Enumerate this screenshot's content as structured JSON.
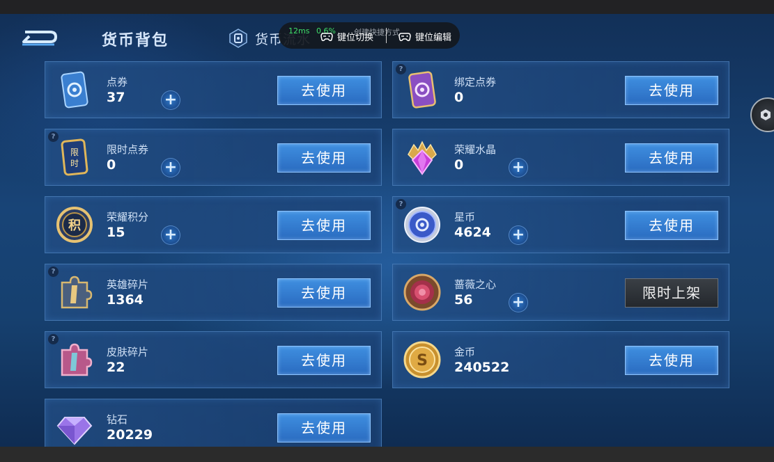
{
  "header": {
    "title": "货币背包",
    "flow_tab": "货币流水"
  },
  "overlay": {
    "latency": "12ms",
    "percent": "0.6%",
    "ghost_text": "创建快捷方式",
    "switch_label": "键位切换",
    "edit_label": "键位编辑"
  },
  "currencies": [
    {
      "name": "点券",
      "amount": "37",
      "plus": true,
      "help": false,
      "action": "去使用"
    },
    {
      "name": "绑定点券",
      "amount": "0",
      "plus": false,
      "help": true,
      "action": "去使用"
    },
    {
      "name": "限时点券",
      "amount": "0",
      "plus": true,
      "help": true,
      "action": "去使用"
    },
    {
      "name": "荣耀水晶",
      "amount": "0",
      "plus": true,
      "help": false,
      "action": "去使用"
    },
    {
      "name": "荣耀积分",
      "amount": "15",
      "plus": true,
      "help": false,
      "action": "去使用"
    },
    {
      "name": "星币",
      "amount": "4624",
      "plus": true,
      "help": true,
      "action": "去使用"
    },
    {
      "name": "英雄碎片",
      "amount": "1364",
      "plus": false,
      "help": true,
      "action": "去使用"
    },
    {
      "name": "蔷薇之心",
      "amount": "56",
      "plus": true,
      "help": false,
      "action": "限时上架"
    },
    {
      "name": "皮肤碎片",
      "amount": "22",
      "plus": false,
      "help": true,
      "action": "去使用"
    },
    {
      "name": "金币",
      "amount": "240522",
      "plus": false,
      "help": false,
      "action": "去使用"
    },
    {
      "name": "钻石",
      "amount": "20229",
      "plus": false,
      "help": false,
      "action": "去使用"
    }
  ],
  "icons": {
    "back": "back-arrow-icon",
    "flow": "currency-flow-icon",
    "gamepad": "gamepad-icon",
    "side": "hexagon-settings-icon"
  },
  "colors": {
    "use_button": "#2f7ad0",
    "limited_button": "#2e3338",
    "overlay_green": "#3fe06a"
  }
}
